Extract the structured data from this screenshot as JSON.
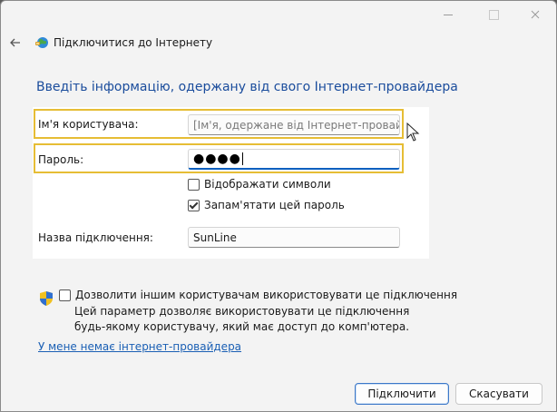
{
  "window": {
    "nav_title": "Підключитися до Інтернету"
  },
  "heading": "Введіть інформацію, одержану від свого Інтернет-провайдера",
  "form": {
    "username_label": "Ім'я користувача:",
    "username_placeholder": "[Ім'я, одержане від Інтернет-провайдера]",
    "password_label": "Пароль:",
    "password_value": "●●●●",
    "show_chars_label": "Відображати символи",
    "show_chars_checked": false,
    "remember_label": "Запам'ятати цей пароль",
    "remember_checked": true,
    "connection_name_label": "Назва підключення:",
    "connection_name_value": "SunLine"
  },
  "sharing": {
    "allow_label": "Дозволити іншим користувачам використовувати це підключення",
    "allow_checked": false,
    "description": "Цей параметр дозволяє використовувати це підключення будь-якому користувачу, який має доступ до комп'ютера."
  },
  "no_isp_link": "У мене немає інтернет-провайдера",
  "buttons": {
    "connect": "Підключити",
    "cancel": "Скасувати"
  },
  "colors": {
    "highlight": "#e6bd35",
    "heading": "#1a4c9c",
    "link": "#1a5fb4",
    "focus": "#0a5fbf"
  },
  "icons": {
    "back": "back-arrow-icon",
    "network": "globe-network-icon",
    "shield": "uac-shield-icon",
    "cursor": "mouse-pointer-icon"
  }
}
